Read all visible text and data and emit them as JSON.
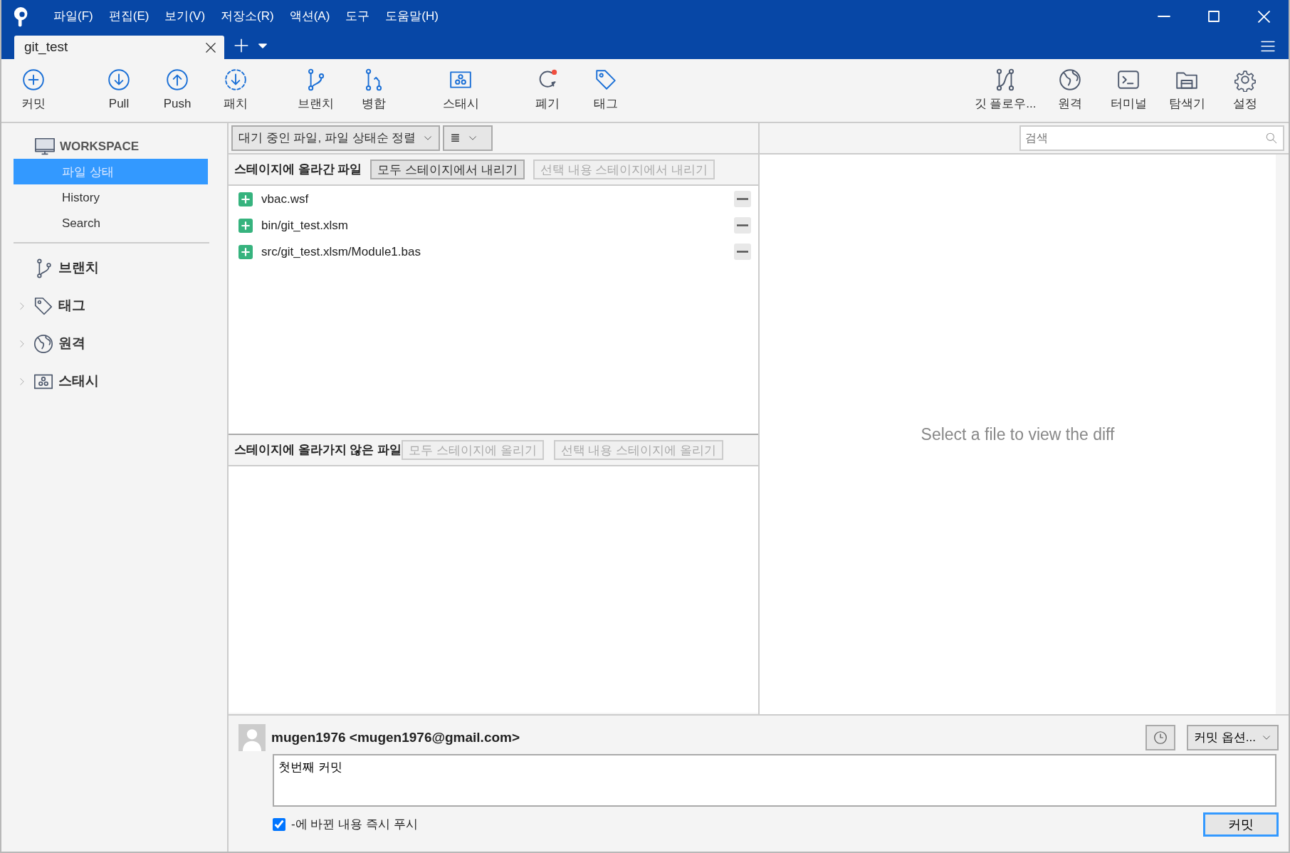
{
  "window": {
    "menu": [
      "파일(F)",
      "편집(E)",
      "보기(V)",
      "저장소(R)",
      "액션(A)",
      "도구",
      "도움말(H)"
    ]
  },
  "tabs": [
    {
      "label": "git_test",
      "selected": true
    }
  ],
  "toolbar": {
    "left": [
      {
        "kind": "commit",
        "label": "커밋"
      },
      {
        "kind": "pull",
        "label": "Pull"
      },
      {
        "kind": "push",
        "label": "Push"
      },
      {
        "kind": "patch",
        "label": "패치"
      },
      {
        "kind": "branch",
        "label": "브랜치"
      },
      {
        "kind": "merge",
        "label": "병합"
      },
      {
        "kind": "stash",
        "label": "스태시"
      },
      {
        "kind": "discard",
        "label": "폐기"
      },
      {
        "kind": "tag",
        "label": "태그"
      }
    ],
    "right": [
      {
        "kind": "flow",
        "label": "깃 플로우..."
      },
      {
        "kind": "remote",
        "label": "원격"
      },
      {
        "kind": "terminal",
        "label": "터미널"
      },
      {
        "kind": "explorer",
        "label": "탐색기"
      },
      {
        "kind": "settings",
        "label": "설정"
      }
    ]
  },
  "sidebar": {
    "workspace": {
      "title": "WORKSPACE",
      "items": [
        {
          "label": "파일 상태",
          "selected": true
        },
        {
          "label": "History",
          "selected": false
        },
        {
          "label": "Search",
          "selected": false
        }
      ]
    },
    "groups": [
      {
        "kind": "branch",
        "label": "브랜치",
        "expandable": false
      },
      {
        "kind": "tag",
        "label": "태그",
        "expandable": true
      },
      {
        "kind": "remote",
        "label": "원격",
        "expandable": true
      },
      {
        "kind": "stash",
        "label": "스태시",
        "expandable": true
      }
    ]
  },
  "file_filter": {
    "sort": "대기 중인 파일, 파일 상태순 정렬",
    "view": "≣"
  },
  "search": {
    "placeholder": "검색"
  },
  "staged": {
    "title": "스테이지에 올라간 파일",
    "buttons": [
      {
        "label": "모두 스테이지에서 내리기",
        "disabled": false
      },
      {
        "label": "선택 내용 스테이지에서 내리기",
        "disabled": true
      }
    ],
    "files": [
      {
        "path": "vbac.wsf"
      },
      {
        "path": "bin/git_test.xlsm"
      },
      {
        "path": "src/git_test.xlsm/Module1.bas"
      }
    ]
  },
  "unstaged": {
    "title": "스테이지에 올라가지 않은 파일",
    "buttons": [
      {
        "label": "모두 스테이지에 올리기",
        "disabled": true
      },
      {
        "label": "선택 내용 스테이지에 올리기",
        "disabled": true
      }
    ]
  },
  "diff": {
    "message": "Select a file to view the diff"
  },
  "commit": {
    "author": "mugen1976 <mugen1976@gmail.com>",
    "options": "커밋 옵션...",
    "message": "첫번째 커밋",
    "push": {
      "label": "-에 바뀐 내용 즉시 푸시",
      "checked": true
    },
    "submit": "커밋"
  }
}
